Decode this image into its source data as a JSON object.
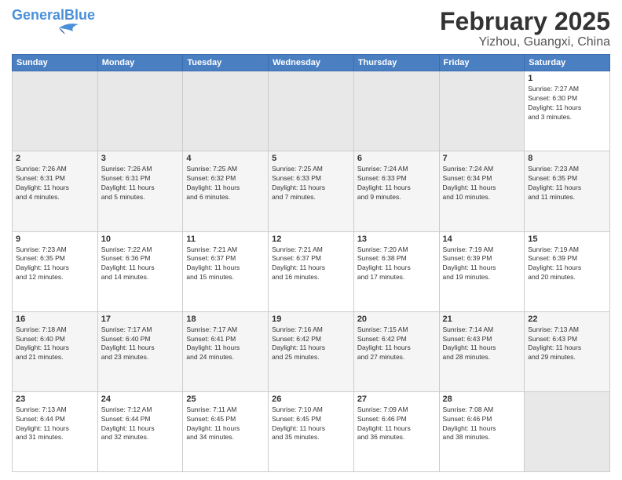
{
  "logo": {
    "text_general": "General",
    "text_blue": "Blue"
  },
  "title": "February 2025",
  "subtitle": "Yizhou, Guangxi, China",
  "weekdays": [
    "Sunday",
    "Monday",
    "Tuesday",
    "Wednesday",
    "Thursday",
    "Friday",
    "Saturday"
  ],
  "weeks": [
    [
      {
        "day": "",
        "info": ""
      },
      {
        "day": "",
        "info": ""
      },
      {
        "day": "",
        "info": ""
      },
      {
        "day": "",
        "info": ""
      },
      {
        "day": "",
        "info": ""
      },
      {
        "day": "",
        "info": ""
      },
      {
        "day": "1",
        "info": "Sunrise: 7:27 AM\nSunset: 6:30 PM\nDaylight: 11 hours\nand 3 minutes."
      }
    ],
    [
      {
        "day": "2",
        "info": "Sunrise: 7:26 AM\nSunset: 6:31 PM\nDaylight: 11 hours\nand 4 minutes."
      },
      {
        "day": "3",
        "info": "Sunrise: 7:26 AM\nSunset: 6:31 PM\nDaylight: 11 hours\nand 5 minutes."
      },
      {
        "day": "4",
        "info": "Sunrise: 7:25 AM\nSunset: 6:32 PM\nDaylight: 11 hours\nand 6 minutes."
      },
      {
        "day": "5",
        "info": "Sunrise: 7:25 AM\nSunset: 6:33 PM\nDaylight: 11 hours\nand 7 minutes."
      },
      {
        "day": "6",
        "info": "Sunrise: 7:24 AM\nSunset: 6:33 PM\nDaylight: 11 hours\nand 9 minutes."
      },
      {
        "day": "7",
        "info": "Sunrise: 7:24 AM\nSunset: 6:34 PM\nDaylight: 11 hours\nand 10 minutes."
      },
      {
        "day": "8",
        "info": "Sunrise: 7:23 AM\nSunset: 6:35 PM\nDaylight: 11 hours\nand 11 minutes."
      }
    ],
    [
      {
        "day": "9",
        "info": "Sunrise: 7:23 AM\nSunset: 6:35 PM\nDaylight: 11 hours\nand 12 minutes."
      },
      {
        "day": "10",
        "info": "Sunrise: 7:22 AM\nSunset: 6:36 PM\nDaylight: 11 hours\nand 14 minutes."
      },
      {
        "day": "11",
        "info": "Sunrise: 7:21 AM\nSunset: 6:37 PM\nDaylight: 11 hours\nand 15 minutes."
      },
      {
        "day": "12",
        "info": "Sunrise: 7:21 AM\nSunset: 6:37 PM\nDaylight: 11 hours\nand 16 minutes."
      },
      {
        "day": "13",
        "info": "Sunrise: 7:20 AM\nSunset: 6:38 PM\nDaylight: 11 hours\nand 17 minutes."
      },
      {
        "day": "14",
        "info": "Sunrise: 7:19 AM\nSunset: 6:39 PM\nDaylight: 11 hours\nand 19 minutes."
      },
      {
        "day": "15",
        "info": "Sunrise: 7:19 AM\nSunset: 6:39 PM\nDaylight: 11 hours\nand 20 minutes."
      }
    ],
    [
      {
        "day": "16",
        "info": "Sunrise: 7:18 AM\nSunset: 6:40 PM\nDaylight: 11 hours\nand 21 minutes."
      },
      {
        "day": "17",
        "info": "Sunrise: 7:17 AM\nSunset: 6:40 PM\nDaylight: 11 hours\nand 23 minutes."
      },
      {
        "day": "18",
        "info": "Sunrise: 7:17 AM\nSunset: 6:41 PM\nDaylight: 11 hours\nand 24 minutes."
      },
      {
        "day": "19",
        "info": "Sunrise: 7:16 AM\nSunset: 6:42 PM\nDaylight: 11 hours\nand 25 minutes."
      },
      {
        "day": "20",
        "info": "Sunrise: 7:15 AM\nSunset: 6:42 PM\nDaylight: 11 hours\nand 27 minutes."
      },
      {
        "day": "21",
        "info": "Sunrise: 7:14 AM\nSunset: 6:43 PM\nDaylight: 11 hours\nand 28 minutes."
      },
      {
        "day": "22",
        "info": "Sunrise: 7:13 AM\nSunset: 6:43 PM\nDaylight: 11 hours\nand 29 minutes."
      }
    ],
    [
      {
        "day": "23",
        "info": "Sunrise: 7:13 AM\nSunset: 6:44 PM\nDaylight: 11 hours\nand 31 minutes."
      },
      {
        "day": "24",
        "info": "Sunrise: 7:12 AM\nSunset: 6:44 PM\nDaylight: 11 hours\nand 32 minutes."
      },
      {
        "day": "25",
        "info": "Sunrise: 7:11 AM\nSunset: 6:45 PM\nDaylight: 11 hours\nand 34 minutes."
      },
      {
        "day": "26",
        "info": "Sunrise: 7:10 AM\nSunset: 6:45 PM\nDaylight: 11 hours\nand 35 minutes."
      },
      {
        "day": "27",
        "info": "Sunrise: 7:09 AM\nSunset: 6:46 PM\nDaylight: 11 hours\nand 36 minutes."
      },
      {
        "day": "28",
        "info": "Sunrise: 7:08 AM\nSunset: 6:46 PM\nDaylight: 11 hours\nand 38 minutes."
      },
      {
        "day": "",
        "info": ""
      }
    ]
  ]
}
